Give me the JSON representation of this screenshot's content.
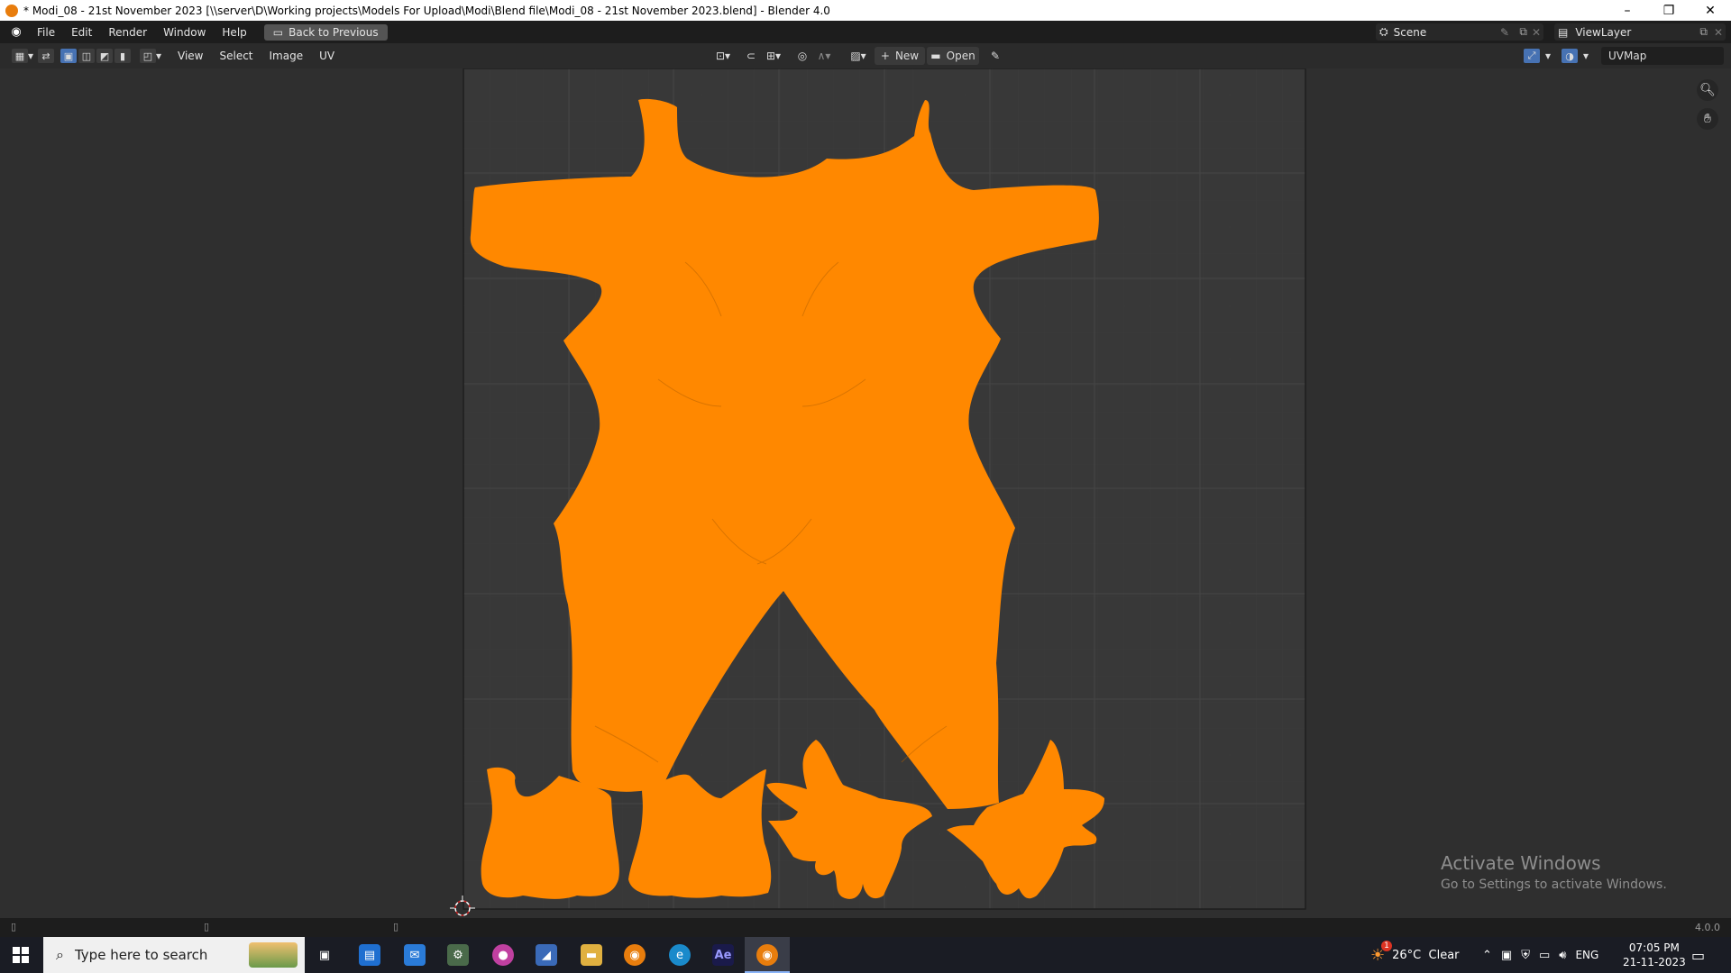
{
  "window": {
    "title": "* Modi_08 - 21st November 2023 [\\\\server\\D\\Working projects\\Models For Upload\\Modi\\Blend file\\Modi_08 - 21st November 2023.blend] - Blender 4.0",
    "controls": [
      "–",
      "❐",
      "✕"
    ]
  },
  "menu": {
    "items": [
      "File",
      "Edit",
      "Render",
      "Window",
      "Help"
    ],
    "back_label": "Back to Previous"
  },
  "scene": {
    "label": "Scene"
  },
  "viewlayer": {
    "label": "ViewLayer"
  },
  "editor": {
    "menus": [
      "View",
      "Select",
      "Image",
      "UV"
    ],
    "new_label": "New",
    "open_label": "Open",
    "uvmap": "UVMap"
  },
  "watermark": {
    "title": "Activate Windows",
    "subtitle": "Go to Settings to activate Windows."
  },
  "status": {
    "version": "4.0.0"
  },
  "taskbar": {
    "search_placeholder": "Type here to search",
    "weather": "26°C  Clear",
    "language": "ENG",
    "time": "07:05 PM",
    "date": "21-11-2023",
    "notification_count": "1"
  },
  "colors": {
    "uv_fill": "#ff8800",
    "accent_blue": "#4772b3",
    "viewport_bg": "#2f2f2f"
  }
}
